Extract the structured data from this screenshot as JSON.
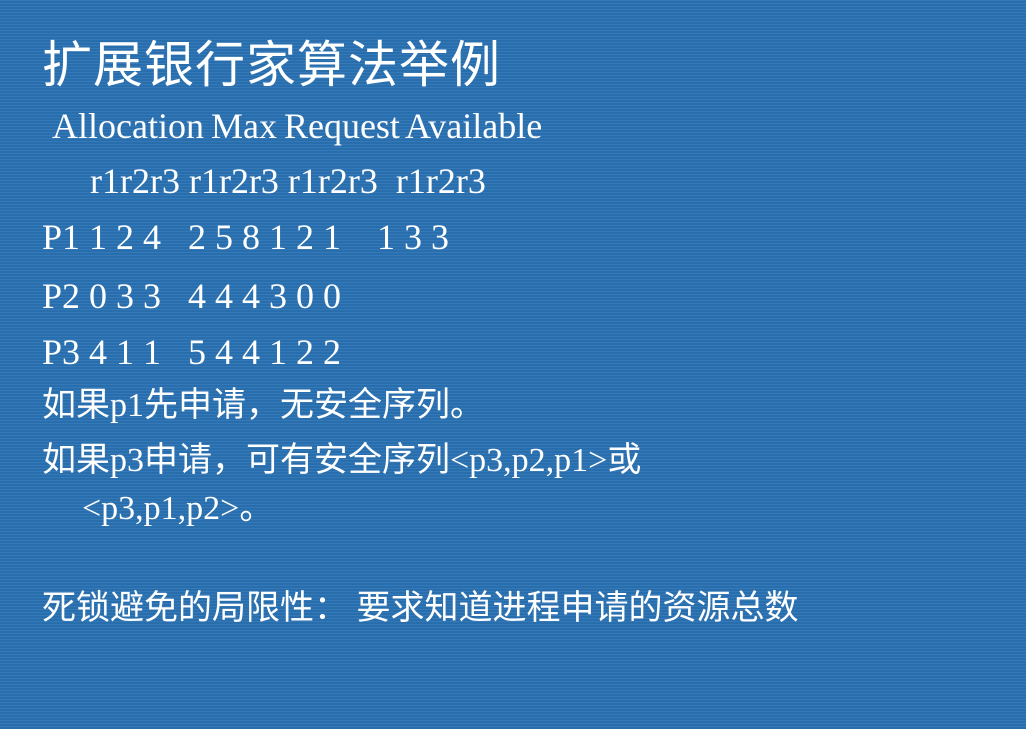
{
  "title": "扩展银行家算法举例",
  "table": {
    "headers": "Allocation Max Request Available",
    "subheaders": "r1r2r3 r1r2r3 r1r2r3  r1r2r3",
    "rows": [
      "P1 1 2 4   2 5 8 1 2 1    1 3 3",
      "P2 0 3 3   4 4 4 3 0 0",
      "P3 4 1 1   5 4 4 1 2 2"
    ]
  },
  "notes": [
    "如果p1先申请，无安全序列。",
    "如果p3申请，可有安全序列<p3,p2,p1>或",
    "<p3,p1,p2>。"
  ],
  "limitation": "死锁避免的局限性： 要求知道进程申请的资源总数"
}
